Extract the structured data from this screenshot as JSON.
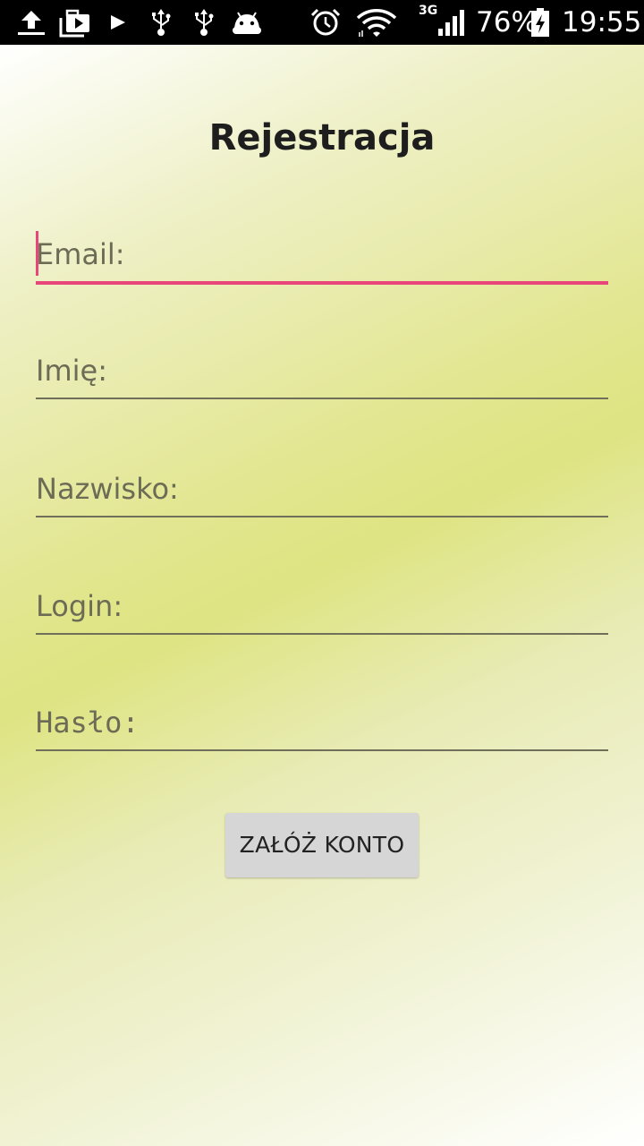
{
  "status_bar": {
    "icons": [
      "upload-icon",
      "media-share-icon",
      "play-icon",
      "usb-icon",
      "usb-icon",
      "android-icon",
      "alarm-icon",
      "wifi-icon",
      "signal-icon",
      "battery-charging-icon"
    ],
    "network_type": "3G",
    "battery_percent": "76%",
    "time": "19:55"
  },
  "screen": {
    "title": "Rejestracja",
    "fields": {
      "email": {
        "placeholder": "Email:",
        "active": true
      },
      "first_name": {
        "placeholder": "Imię:"
      },
      "last_name": {
        "placeholder": "Nazwisko:"
      },
      "login": {
        "placeholder": "Login:"
      },
      "password": {
        "placeholder": "Hasło:"
      }
    },
    "submit_button": "ZAŁÓŻ KONTO"
  },
  "colors": {
    "accent": "#e8457a",
    "gradient_mid": "#dee482",
    "button_bg": "#d6d6d6"
  }
}
